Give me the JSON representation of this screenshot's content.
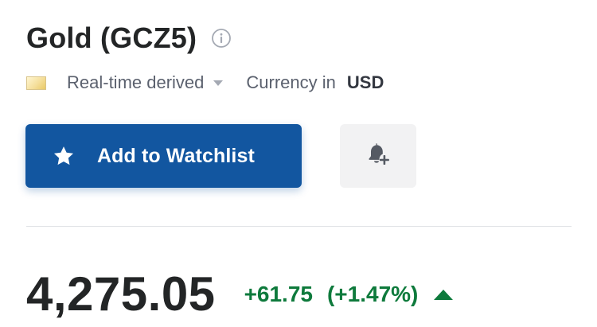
{
  "instrument": {
    "title": "Gold (GCZ5)"
  },
  "meta": {
    "data_type": "Real-time derived",
    "currency_label": "Currency in",
    "currency_code": "USD"
  },
  "actions": {
    "watchlist_label": "Add to Watchlist"
  },
  "quote": {
    "price": "4,275.05",
    "change": "+61.75",
    "change_percent": "(+1.47%)",
    "direction": "up"
  },
  "colors": {
    "primary_button": "#1256a0",
    "positive": "#0e7a3c",
    "title_text": "#232526",
    "muted_text": "#5b616e"
  },
  "icons": {
    "info": "info-icon",
    "flag": "gold-flag-icon",
    "dropdown": "caret-down-icon",
    "watchlist": "star-icon",
    "alert": "bell-plus-icon",
    "trend": "up-arrow-icon"
  }
}
